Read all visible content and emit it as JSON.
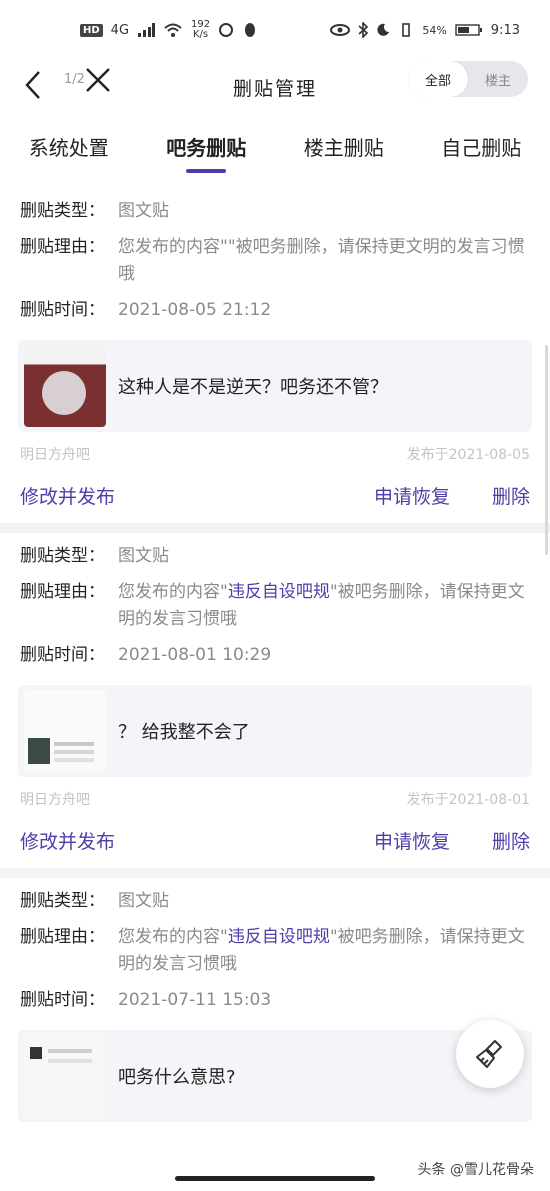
{
  "status_bar": {
    "hd": "HD",
    "net": "4G",
    "speed_top": "192",
    "speed_bottom": "K/s",
    "battery": "54%",
    "time": "9:13"
  },
  "header": {
    "back_icon": "chevron-left-icon",
    "pager": "1/2",
    "close_icon": "close-icon",
    "title": "删贴管理",
    "segment": {
      "all": "全部",
      "owner": "楼主",
      "selected": "全部"
    }
  },
  "tabs": [
    {
      "label": "系统处置",
      "active": false
    },
    {
      "label": "吧务删贴",
      "active": true
    },
    {
      "label": "楼主删贴",
      "active": false
    },
    {
      "label": "自己删贴",
      "active": false
    }
  ],
  "labels": {
    "type": "删贴类型：",
    "reason": "删贴理由：",
    "time": "删贴时间："
  },
  "cards": [
    {
      "type": "图文贴",
      "reason_pre": "您发布的内容\"\"被吧务删除，请保持更文明的发言习惯哦",
      "reason_hl": "",
      "reason_post": "",
      "time": "2021-08-05 21:12",
      "post_title": "这种人是不是逆天？吧务还不管？",
      "forum": "明日方舟吧",
      "published": "发布于2021-08-05"
    },
    {
      "type": "图文贴",
      "reason_pre": "您发布的内容\"",
      "reason_hl": "违反自设吧规",
      "reason_post": "\"被吧务删除，请保持更文明的发言习惯哦",
      "time": "2021-08-01 10:29",
      "post_title": "？ 给我整不会了",
      "forum": "明日方舟吧",
      "published": "发布于2021-08-01"
    },
    {
      "type": "图文贴",
      "reason_pre": "您发布的内容\"",
      "reason_hl": "违反自设吧规",
      "reason_post": "\"被吧务删除，请保持更文明的发言习惯哦",
      "time": "2021-07-11 15:03",
      "post_title": "吧务什么意思?"
    }
  ],
  "actions": {
    "edit": "修改并发布",
    "restore": "申请恢复",
    "delete": "删除"
  },
  "fab_icon": "broom-icon",
  "watermark": "头条 @雪儿花骨朵",
  "colors": {
    "accent": "#4b3fa8",
    "muted": "#8a8a8a"
  }
}
